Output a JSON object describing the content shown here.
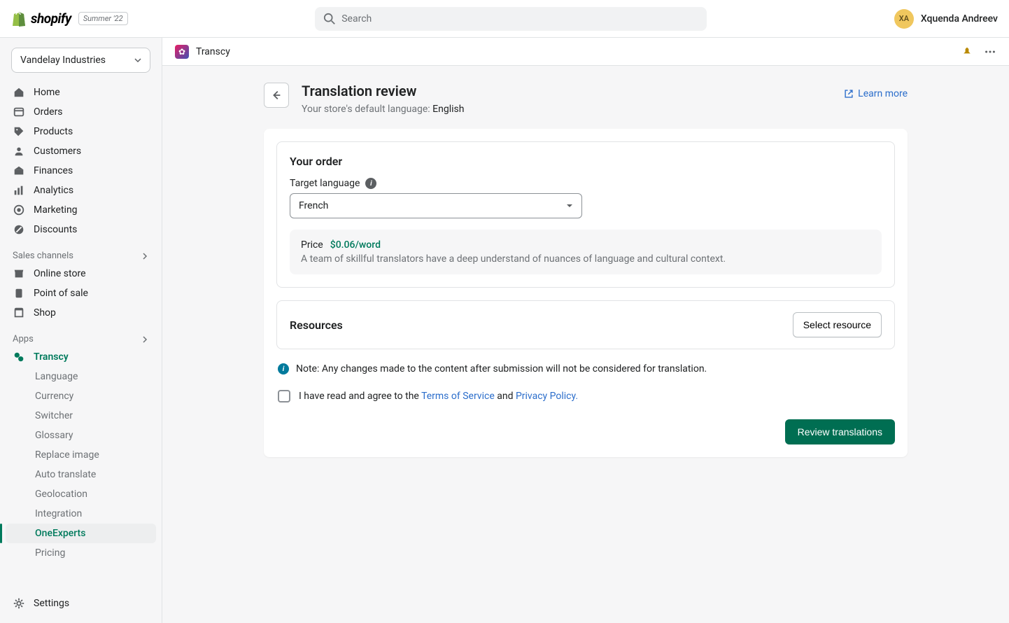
{
  "topbar": {
    "logo_text": "shopify",
    "badge": "Summer '22",
    "search_placeholder": "Search",
    "user_initials": "XA",
    "user_name": "Xquenda Andreev"
  },
  "sidebar": {
    "store_name": "Vandelay Industries",
    "nav": [
      {
        "label": "Home",
        "icon": "home"
      },
      {
        "label": "Orders",
        "icon": "orders"
      },
      {
        "label": "Products",
        "icon": "products"
      },
      {
        "label": "Customers",
        "icon": "customers"
      },
      {
        "label": "Finances",
        "icon": "finances"
      },
      {
        "label": "Analytics",
        "icon": "analytics"
      },
      {
        "label": "Marketing",
        "icon": "marketing"
      },
      {
        "label": "Discounts",
        "icon": "discounts"
      }
    ],
    "sales_channels_label": "Sales channels",
    "channels": [
      {
        "label": "Online store",
        "icon": "store"
      },
      {
        "label": "Point of sale",
        "icon": "pos"
      },
      {
        "label": "Shop",
        "icon": "shop"
      }
    ],
    "apps_label": "Apps",
    "app_name": "Transcy",
    "app_subnav": [
      "Language",
      "Currency",
      "Switcher",
      "Glossary",
      "Replace image",
      "Auto translate",
      "Geolocation",
      "Integration",
      "OneExperts",
      "Pricing"
    ],
    "app_active_index": 8,
    "settings_label": "Settings"
  },
  "appbar": {
    "name": "Transcy"
  },
  "page": {
    "title": "Translation review",
    "subtitle_prefix": "Your store's default language: ",
    "subtitle_value": "English",
    "learn_more": "Learn more"
  },
  "order_card": {
    "title": "Your order",
    "target_language_label": "Target language",
    "target_language_value": "French",
    "price_label": "Price",
    "price_value": "$0.06/word",
    "price_description": "A team of skillful translators have a deep understand of nuances of language and cultural context."
  },
  "resources_card": {
    "title": "Resources",
    "button": "Select resource"
  },
  "note": {
    "text": "Note: Any changes made to the content after submission will not be considered for translation."
  },
  "agree": {
    "prefix": "I have read and agree to the ",
    "tos": "Terms of Service",
    "and": " and ",
    "privacy": "Privacy Policy."
  },
  "actions": {
    "review": "Review translations"
  }
}
